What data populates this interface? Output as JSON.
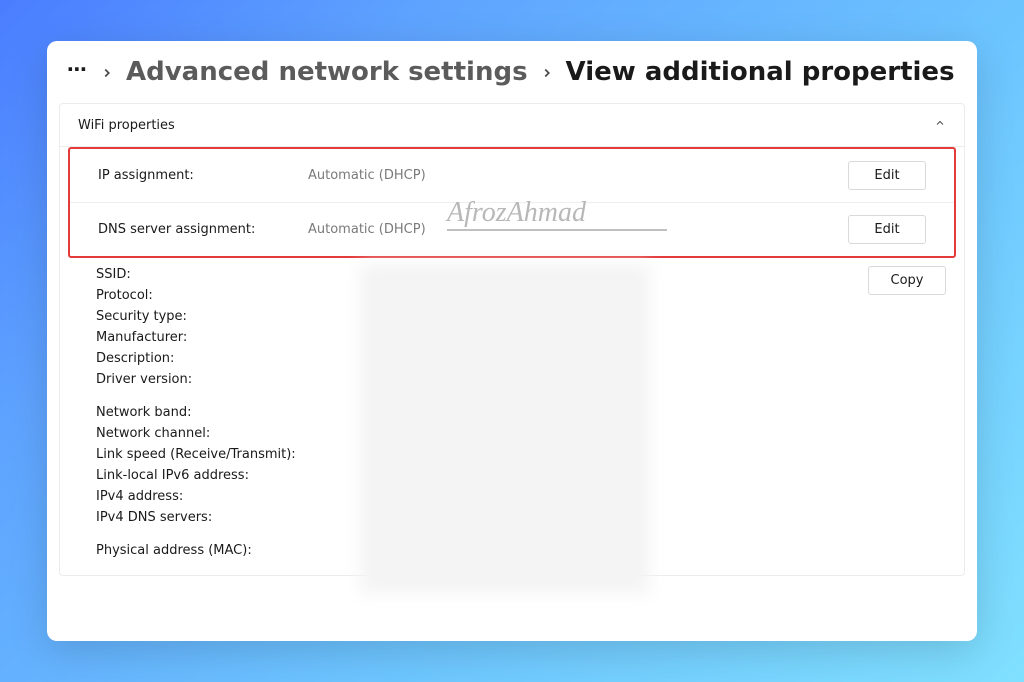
{
  "breadcrumb": {
    "more": "⋯",
    "crumb1": "Advanced network settings",
    "crumb2": "View additional properties"
  },
  "panel": {
    "title": "WiFi properties"
  },
  "rows": {
    "ip": {
      "label": "IP assignment:",
      "value": "Automatic (DHCP)",
      "button": "Edit"
    },
    "dns": {
      "label": "DNS server assignment:",
      "value": "Automatic (DHCP)",
      "button": "Edit"
    }
  },
  "copy_label": "Copy",
  "details": {
    "ssid": "SSID:",
    "protocol": "Protocol:",
    "security": "Security type:",
    "manufacturer": "Manufacturer:",
    "description": "Description:",
    "driver": "Driver version:",
    "band": "Network band:",
    "channel": "Network channel:",
    "linkspeed": "Link speed (Receive/Transmit):",
    "linklocal": "Link-local IPv6 address:",
    "ipv4": "IPv4 address:",
    "ipv4dns": "IPv4 DNS servers:",
    "mac": "Physical address (MAC):"
  },
  "watermark": "AfrozAhmad"
}
